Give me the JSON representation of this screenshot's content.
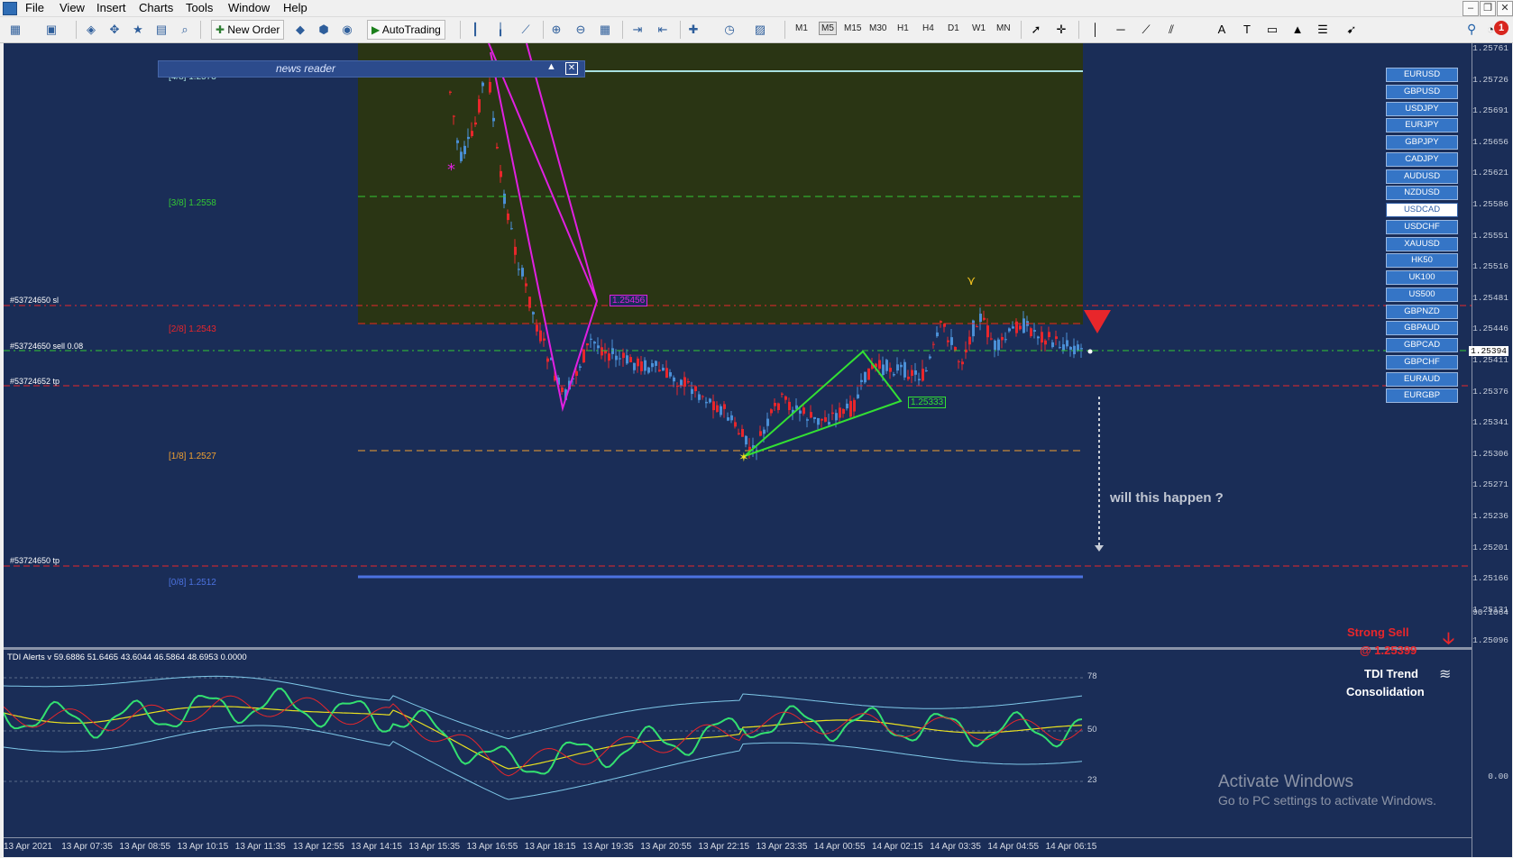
{
  "menu": [
    "File",
    "View",
    "Insert",
    "Charts",
    "Tools",
    "Window",
    "Help"
  ],
  "toolbar": {
    "new_order": "New Order",
    "autotrading": "AutoTrading",
    "timeframes": [
      "M1",
      "M5",
      "M15",
      "M30",
      "H1",
      "H4",
      "D1",
      "W1",
      "MN"
    ],
    "active_timeframe": "M5",
    "notifications": "1"
  },
  "news_reader": {
    "title": "news reader"
  },
  "murrey": [
    {
      "label": "[4/8]",
      "value": "1.2573"
    },
    {
      "label": "[3/8]",
      "value": "1.2558"
    },
    {
      "label": "[2/8]",
      "value": "1.2543"
    },
    {
      "label": "[1/8]",
      "value": "1.2527"
    },
    {
      "label": "[0/8]",
      "value": "1.2512"
    }
  ],
  "orders": {
    "sl": "#53724650 sl",
    "sell": "#53724650 sell 0.08",
    "tp1": "#53724652 tp",
    "tp2": "#53724650 tp"
  },
  "pattern_labels": {
    "magenta": "1.25456",
    "green": "1.25333"
  },
  "question": "will this happen ?",
  "symbols": [
    "EURUSD",
    "GBPUSD",
    "USDJPY",
    "EURJPY",
    "GBPJPY",
    "CADJPY",
    "AUDUSD",
    "NZDUSD",
    "USDCAD",
    "USDCHF",
    "XAUUSD",
    "HK50",
    "UK100",
    "US500",
    "GBPNZD",
    "GBPAUD",
    "GBPCAD",
    "GBPCHF",
    "EURAUD",
    "EURGBP"
  ],
  "active_symbol": "USDCAD",
  "price_axis": [
    "1.25761",
    "1.25726",
    "1.25691",
    "1.25656",
    "1.25621",
    "1.25586",
    "1.25551",
    "1.25516",
    "1.25481",
    "1.25446",
    "1.25411",
    "1.25376",
    "1.25341",
    "1.25306",
    "1.25271",
    "1.25236",
    "1.25201",
    "1.25166",
    "1.25131",
    "1.25096"
  ],
  "current_price": "1.25394",
  "tdi": {
    "title": "TDI Alerts v 59.6886 51.6465 43.6044 46.5864 48.6953 0.0000",
    "levels": [
      "78",
      "50",
      "23"
    ],
    "axis_top": "90.1064",
    "axis_bottom": "0.00",
    "signal_strength": "Strong Sell",
    "signal_price": "@ 1.25399",
    "trend_label": "TDI Trend",
    "trend_state": "Consolidation"
  },
  "time_axis": [
    "13 Apr 2021",
    "13 Apr 07:35",
    "13 Apr 08:55",
    "13 Apr 10:15",
    "13 Apr 11:35",
    "13 Apr 12:55",
    "13 Apr 14:15",
    "13 Apr 15:35",
    "13 Apr 16:55",
    "13 Apr 18:15",
    "13 Apr 19:35",
    "13 Apr 20:55",
    "13 Apr 22:15",
    "13 Apr 23:35",
    "14 Apr 00:55",
    "14 Apr 02:15",
    "14 Apr 03:35",
    "14 Apr 04:55",
    "14 Apr 06:15"
  ],
  "watermark": {
    "line1": "Activate Windows",
    "line2": "Go to PC settings to activate Windows."
  },
  "colors": {
    "background": "#1a2d57",
    "bull": "#4a8fd6",
    "bear": "#e8262b",
    "zone": "#2a3514",
    "magenta": "#e020e0",
    "green": "#33e033"
  }
}
